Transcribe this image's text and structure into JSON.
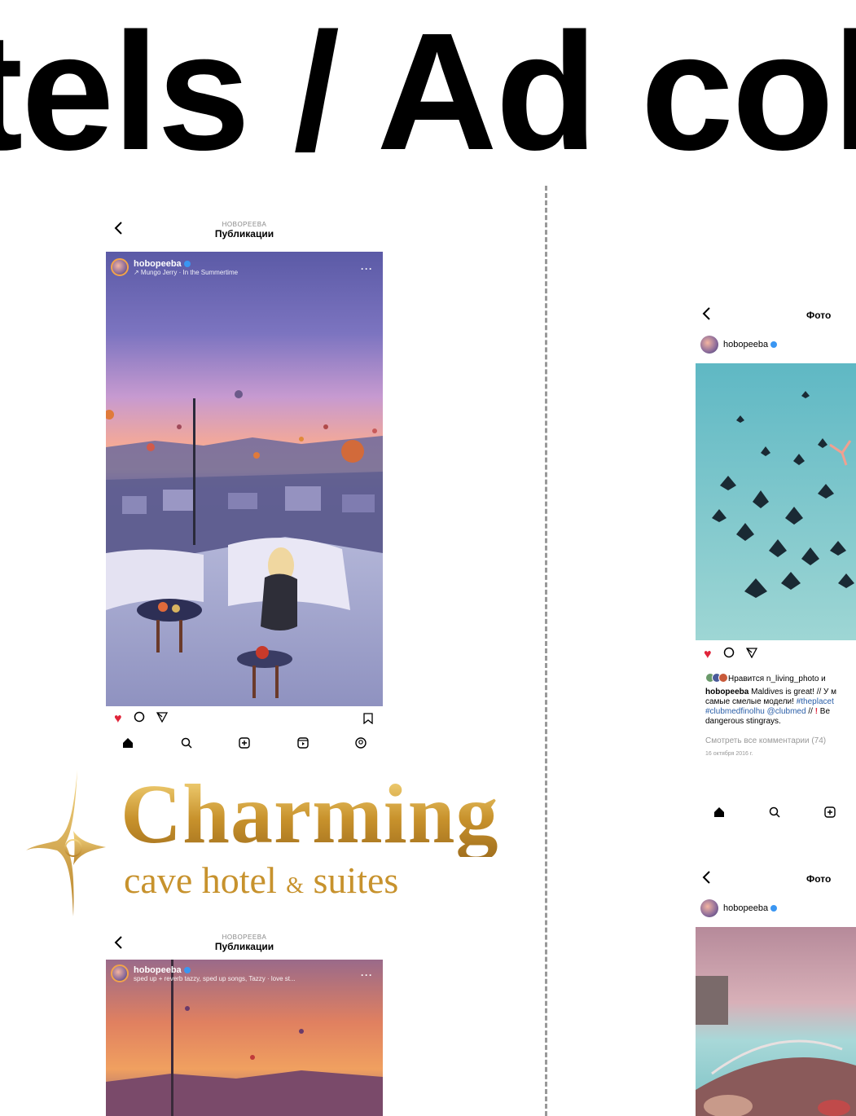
{
  "page": {
    "title": "tels / Ad col"
  },
  "left_post_1": {
    "header_sub": "HOBOPEEBA",
    "header_title": "Публикации",
    "username": "hobopeeba",
    "music": "↗ Mungo Jerry · In the Summertime",
    "more": "···"
  },
  "logo": {
    "name": "Charming",
    "tagline_1": "cave hotel ",
    "tagline_amp": "&",
    "tagline_2": " suites"
  },
  "left_post_2": {
    "header_sub": "HOBOPEEBA",
    "header_title": "Публикации",
    "username": "hobopeeba",
    "music": "sped up + reverb tazzy, sped up songs, Tazzy · love st...",
    "more": "···"
  },
  "right_post_1": {
    "header_title": "Фото",
    "username": "hobopeeba",
    "liked_by": "Нравится n_living_photo и",
    "caption_user": "hobopeeba",
    "caption_line1": "Maldives is great! // У м",
    "caption_line2_plain": "самые смелые модели! ",
    "caption_line2_tag": "#theplacet",
    "caption_line3_tag": "#clubmedfinolhu @clubmed",
    "caption_line3_plain": " // ",
    "caption_line3_end": " Be",
    "caption_line4": "dangerous stingrays.",
    "comments": "Смотреть все комментарии (74)",
    "date": "16 октября 2016 г."
  },
  "right_post_2": {
    "header_title": "Фото",
    "username": "hobopeeba"
  },
  "icons": {
    "back": "‹",
    "heart": "♥",
    "comment": "○",
    "share": "▽",
    "bookmark": "⌑",
    "home": "⌂",
    "search": "⚲",
    "add": "⊕",
    "reels": "▣",
    "profile": "◎"
  },
  "colors": {
    "accent_red": "#e0243a",
    "gold": "#c7922d",
    "link_blue": "#2b5fa8"
  }
}
